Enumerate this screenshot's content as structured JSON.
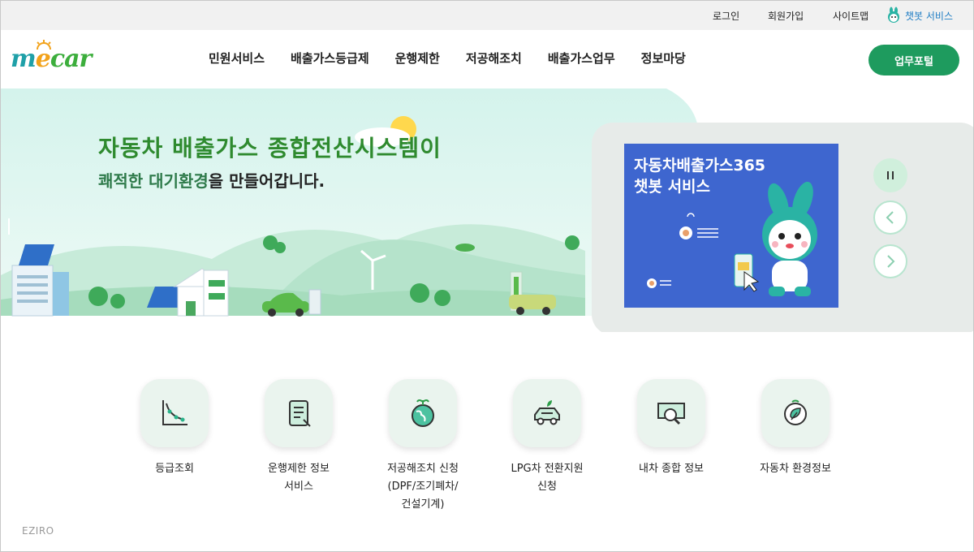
{
  "topbar": {
    "login": "로그인",
    "signup": "회원가입",
    "sitemap": "사이트맵",
    "chatbot": "챗봇 서비스"
  },
  "header": {
    "logo": {
      "m": "m",
      "e": "e",
      "car": "car"
    },
    "nav": [
      "민원서비스",
      "배출가스등급제",
      "운행제한",
      "저공해조치",
      "배출가스업무",
      "정보마당"
    ],
    "portal_button": "업무포털"
  },
  "hero": {
    "title": "자동차 배출가스 종합전산시스템이",
    "subtitle_highlight": "쾌적한 대기환경",
    "subtitle_rest": "을 만들어갑니다."
  },
  "banner": {
    "line1": "자동차배출가스365",
    "line2": "챗봇 서비스"
  },
  "carousel": {
    "pause_icon": "pause-icon",
    "prev_icon": "chevron-left-icon",
    "next_icon": "chevron-right-icon"
  },
  "quick_menu": [
    {
      "label": "등급조회",
      "icon": "chart-icon"
    },
    {
      "label": "운행제한 정보\n서비스",
      "icon": "tablet-icon"
    },
    {
      "label": "저공해조치 신청\n(DPF/조기폐차/\n건설기계)",
      "icon": "globe-icon"
    },
    {
      "label": "LPG차 전환지원\n신청",
      "icon": "car-icon"
    },
    {
      "label": "내차 종합 정보",
      "icon": "search-document-icon"
    },
    {
      "label": "자동차 환경정보",
      "icon": "eco-info-icon"
    }
  ],
  "watermark": "EZIRO",
  "colors": {
    "primary_green": "#1e9b5e",
    "title_green": "#2e8a2e",
    "banner_blue": "#3e66cf"
  }
}
